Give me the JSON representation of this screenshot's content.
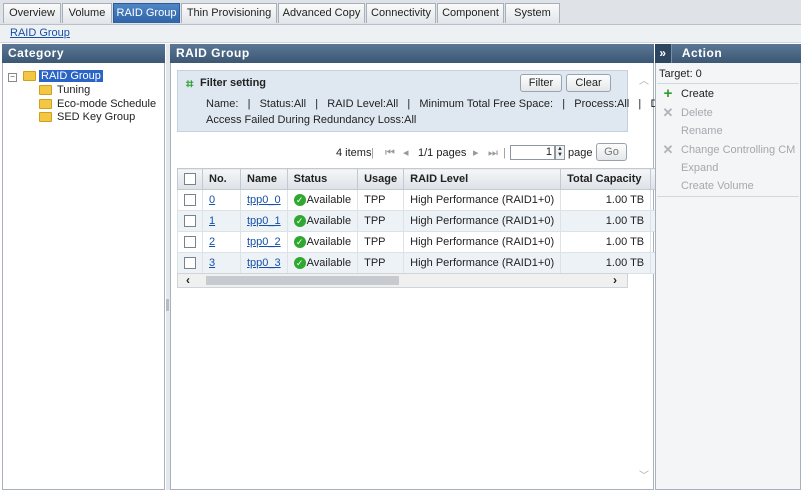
{
  "tabs": [
    {
      "label": "Overview",
      "active": false
    },
    {
      "label": "Volume",
      "active": false
    },
    {
      "label": "RAID Group",
      "active": true
    },
    {
      "label": "Thin Provisioning",
      "active": false
    },
    {
      "label": "Advanced Copy",
      "active": false
    },
    {
      "label": "Connectivity",
      "active": false
    },
    {
      "label": "Component",
      "active": false
    },
    {
      "label": "System",
      "active": false
    }
  ],
  "breadcrumb": "RAID Group",
  "category": {
    "title": "Category",
    "root": "RAID Group",
    "children": [
      "Tuning",
      "Eco-mode Schedule",
      "SED Key Group"
    ]
  },
  "main": {
    "title": "RAID Group",
    "filter": {
      "title": "Filter setting",
      "filter_button": "Filter",
      "clear_button": "Clear",
      "line1": "Name:   |   Status:All   |   RAID Level:All   |   Minimum Total Free Space:   |   Process:All   |   Data",
      "line2": "Access Failed During Redundancy Loss:All"
    },
    "pager": {
      "items": "4 items",
      "pages": "1/1 pages",
      "page_value": "1",
      "page_label": "page",
      "go_button": "Go"
    },
    "columns": [
      "No.",
      "Name",
      "Status",
      "Usage",
      "RAID Level",
      "Total Capacity"
    ],
    "rows": [
      {
        "no": "0",
        "name": "tpp0_0",
        "status": "Available",
        "usage": "TPP",
        "raid": "High Performance (RAID1+0)",
        "capacity": "1.00 TB"
      },
      {
        "no": "1",
        "name": "tpp0_1",
        "status": "Available",
        "usage": "TPP",
        "raid": "High Performance (RAID1+0)",
        "capacity": "1.00 TB"
      },
      {
        "no": "2",
        "name": "tpp0_2",
        "status": "Available",
        "usage": "TPP",
        "raid": "High Performance (RAID1+0)",
        "capacity": "1.00 TB"
      },
      {
        "no": "3",
        "name": "tpp0_3",
        "status": "Available",
        "usage": "TPP",
        "raid": "High Performance (RAID1+0)",
        "capacity": "1.00 TB"
      }
    ]
  },
  "action": {
    "title": "Action",
    "collapse_glyph": "»",
    "target": "Target: 0",
    "items": [
      {
        "label": "Create",
        "enabled": true,
        "icon": "plus-icon"
      },
      {
        "label": "Delete",
        "enabled": false,
        "icon": "x-icon"
      },
      {
        "label": "Rename",
        "enabled": false,
        "icon": ""
      },
      {
        "label": "Change Controlling CM",
        "enabled": false,
        "icon": "tools-icon"
      },
      {
        "label": "Expand",
        "enabled": false,
        "icon": ""
      },
      {
        "label": "Create Volume",
        "enabled": false,
        "icon": ""
      }
    ]
  },
  "colors": {
    "active_tab": "#2f63a6",
    "panel_header": "#3b5774",
    "link": "#1650a8",
    "status_ok": "#2fa82f",
    "create_plus": "#2e9b2e"
  }
}
